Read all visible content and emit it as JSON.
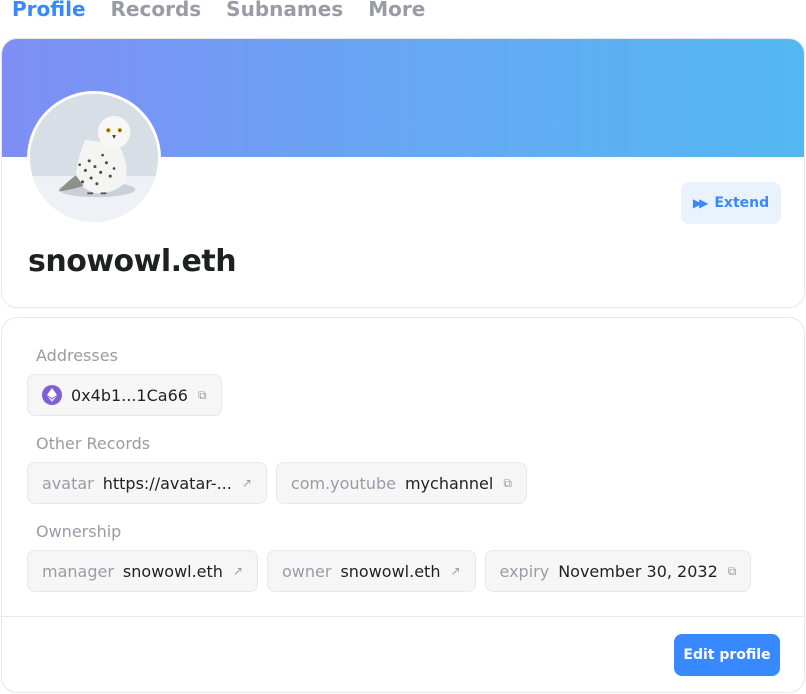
{
  "tabs": [
    {
      "label": "Profile",
      "active": true
    },
    {
      "label": "Records",
      "active": false
    },
    {
      "label": "Subnames",
      "active": false
    },
    {
      "label": "More",
      "active": false
    }
  ],
  "profile": {
    "name": "snowowl.eth",
    "extend_label": "Extend",
    "extend_icon": "fast-forward-icon",
    "banner_gradient": [
      "#7f8ef4",
      "#53b8f1"
    ]
  },
  "addresses": {
    "title": "Addresses",
    "items": [
      {
        "coin_icon": "ethereum-icon",
        "value": "0x4b1...1Ca66",
        "action_icon": "copy-icon"
      }
    ]
  },
  "other_records": {
    "title": "Other Records",
    "items": [
      {
        "key": "avatar",
        "value": "https://avatar-...",
        "action_icon": "external-link-icon"
      },
      {
        "key": "com.youtube",
        "value": "mychannel",
        "action_icon": "copy-icon"
      }
    ]
  },
  "ownership": {
    "title": "Ownership",
    "items": [
      {
        "key": "manager",
        "value": "snowowl.eth",
        "action_icon": "external-link-icon"
      },
      {
        "key": "owner",
        "value": "snowowl.eth",
        "action_icon": "external-link-icon"
      },
      {
        "key": "expiry",
        "value": "November 30, 2032",
        "action_icon": "copy-icon"
      }
    ]
  },
  "footer": {
    "edit_profile_label": "Edit profile"
  },
  "colors": {
    "accent": "#3889ff",
    "muted": "#9b9ba7",
    "eth": "#7f5fd7"
  }
}
